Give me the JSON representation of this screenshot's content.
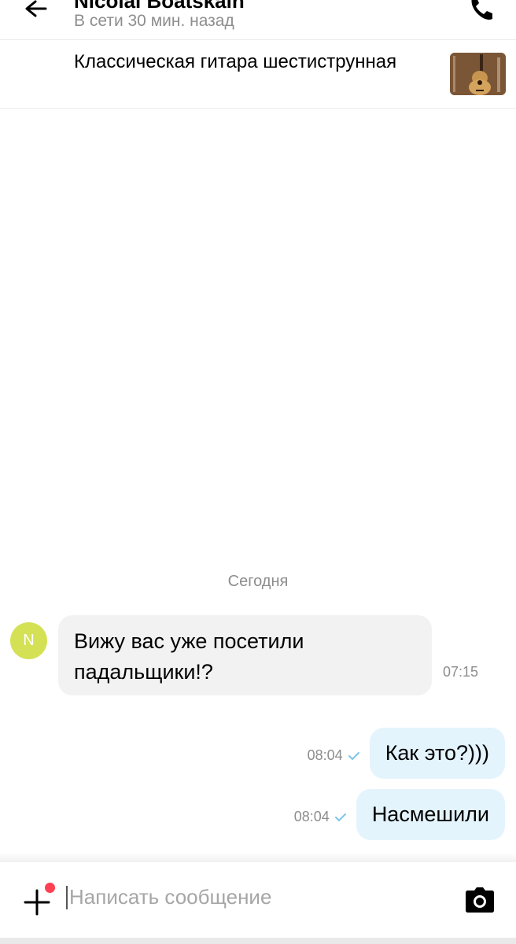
{
  "header": {
    "back_icon": "arrow-left-icon",
    "contact_name": "Nicolai Boatskain",
    "status": "В сети 30 мин. назад",
    "call_icon": "phone-icon"
  },
  "listing": {
    "title": "Классическая гитара шестиструнная",
    "thumbnail_icon": "guitar-thumbnail"
  },
  "chat": {
    "date_separator": "Сегодня",
    "incoming": [
      {
        "avatar_letter": "N",
        "avatar_color": "#d4e155",
        "text": "Вижу вас уже посетили падальщики!?",
        "time": "07:15"
      }
    ],
    "outgoing": [
      {
        "text": "Как это?)))",
        "time": "08:04",
        "status_icon": "check-icon"
      },
      {
        "text": "Насмешили",
        "time": "08:04",
        "status_icon": "check-icon"
      }
    ]
  },
  "composer": {
    "attach_icon": "plus-icon",
    "placeholder": "Написать сообщение",
    "value": "",
    "camera_icon": "camera-icon"
  },
  "colors": {
    "incoming_bubble": "#f2f2f2",
    "outgoing_bubble": "#e4f4fd",
    "check": "#7cc5e6",
    "notification_dot": "#ff4053"
  }
}
